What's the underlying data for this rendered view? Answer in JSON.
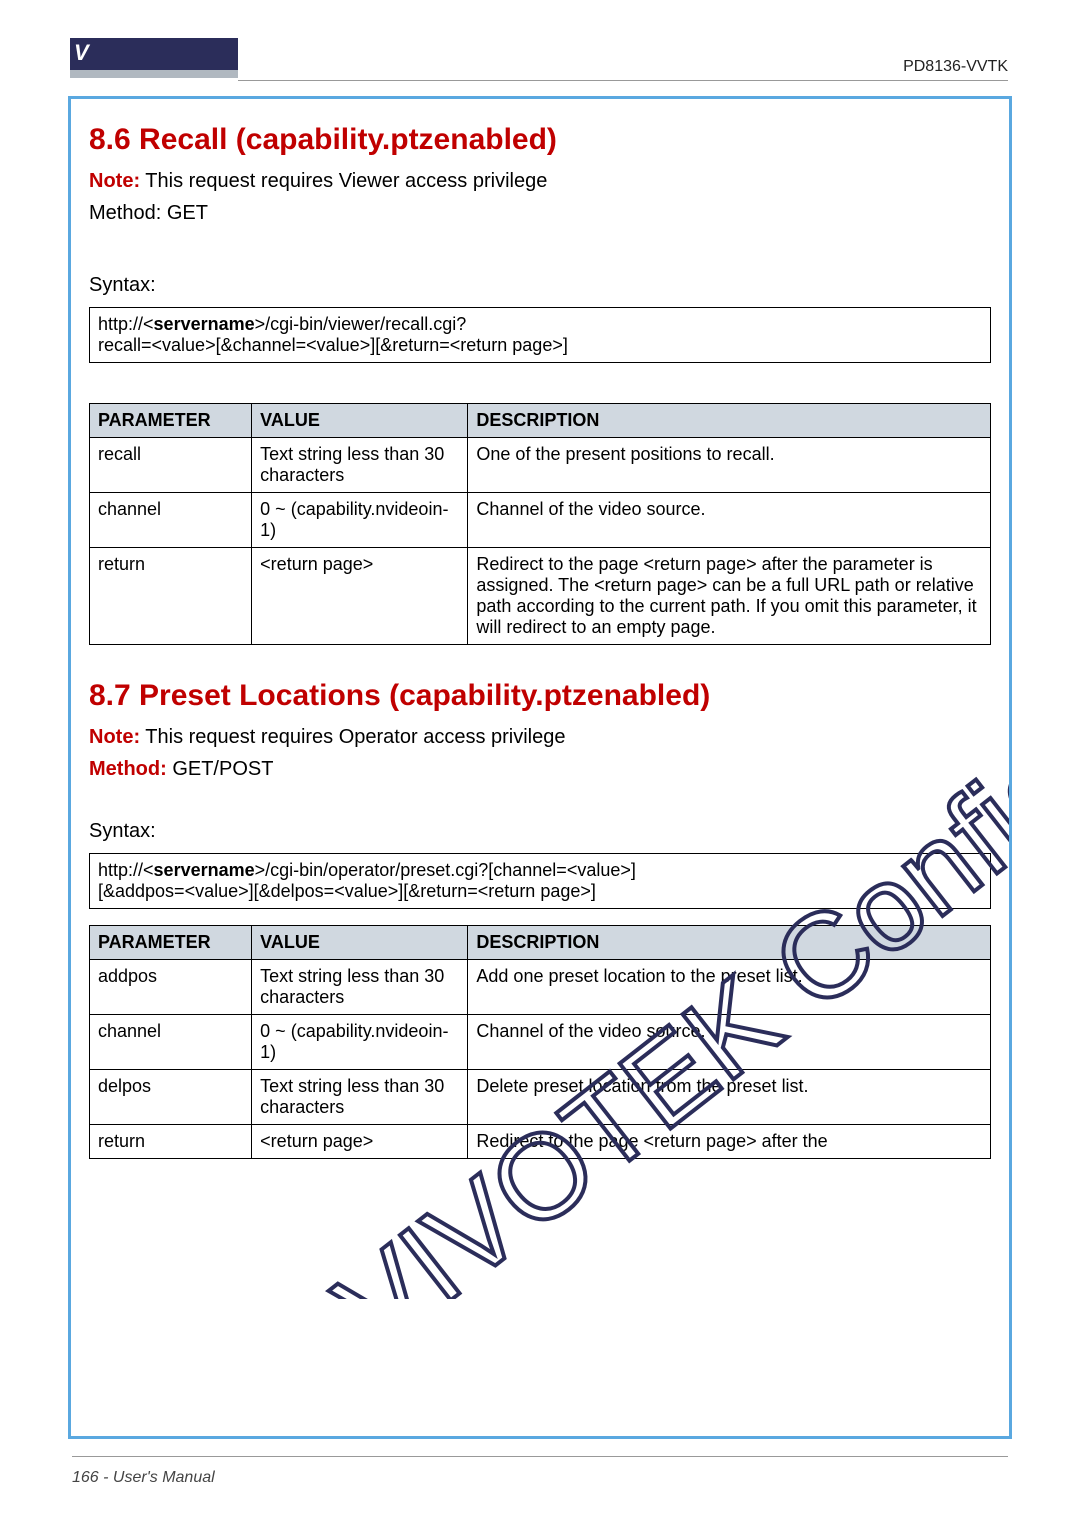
{
  "header": {
    "logo_v": "V",
    "model": "PD8136-VVTK",
    "page_footer": "166 - User's Manual"
  },
  "section86": {
    "title": "8.6 Recall (capability.ptzenabled)",
    "note_label": "Note:",
    "note_text": " This request requires Viewer access privilege",
    "method_intro": "Method: GET",
    "syntax_label": "Syntax:",
    "syntax_line1_prefix": "http://<",
    "syntax_servername": "servername",
    "syntax_line1_suffix": ">/cgi-bin/viewer/recall.cgi?",
    "syntax_line2": "recall=<value>[&channel=<value>][&return=<return page>]",
    "table": {
      "headers": [
        "PARAMETER",
        "VALUE",
        "DESCRIPTION"
      ],
      "rows": [
        {
          "p": "recall",
          "v": "Text string less than 30 characters",
          "d": "One of the present positions to recall."
        },
        {
          "p": "channel",
          "v": "0 ~ (capability.nvideoin-1)",
          "d": "Channel of the video source."
        },
        {
          "p": "return",
          "v": "<return page>",
          "d": "Redirect to the page <return page> after the parameter is assigned. The <return page> can be a full URL path or relative path according to the current path. If you omit this parameter, it will redirect to an empty page."
        }
      ]
    }
  },
  "section87": {
    "title": "8.7 Preset Locations (capability.ptzenabled)",
    "note_label": "Note:",
    "note_text": " This request requires Operator access privilege",
    "method_label": "Method:",
    "method_value": " GET/POST",
    "syntax_label": "Syntax:",
    "syntax_line1_prefix": "http://<",
    "syntax_servername": "servername",
    "syntax_line1_suffix": ">/cgi-bin/operator/preset.cgi?[channel=<value>]",
    "syntax_line2": "[&addpos=<value>][&delpos=<value>][&return=<return page>]",
    "table": {
      "headers": [
        "PARAMETER",
        "VALUE",
        "DESCRIPTION"
      ],
      "rows": [
        {
          "p": "addpos",
          "v": "Text string less than 30 characters",
          "d": "Add one preset location to the preset list."
        },
        {
          "p": "channel",
          "v": "0 ~ (capability.nvideoin-1)",
          "d": "Channel of the video source."
        },
        {
          "p": "delpos",
          "v": "Text string less than 30 characters",
          "d": "Delete preset location from the preset list."
        },
        {
          "p": "return",
          "v": "<return page>",
          "d": "Redirect to the page <return page> after the"
        }
      ]
    }
  },
  "watermark": "VIVOTEK Confidential"
}
